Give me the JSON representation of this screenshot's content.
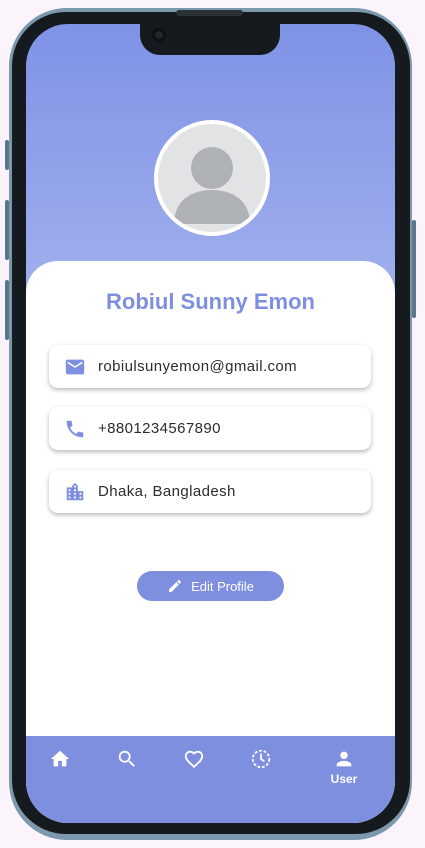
{
  "colors": {
    "accent": "#7f8fe0",
    "card": "#ffffff",
    "text": "#2c2c2c"
  },
  "profile": {
    "name": "Robiul Sunny Emon",
    "email": "robiulsunyemon@gmail.com",
    "phone": "+8801234567890",
    "location": "Dhaka, Bangladesh"
  },
  "actions": {
    "edit_profile_label": "Edit Profile"
  },
  "bottom_nav": {
    "items": [
      {
        "icon": "home-icon",
        "label": ""
      },
      {
        "icon": "search-icon",
        "label": ""
      },
      {
        "icon": "heart-icon",
        "label": ""
      },
      {
        "icon": "history-icon",
        "label": ""
      },
      {
        "icon": "user-icon",
        "label": "User"
      }
    ]
  }
}
